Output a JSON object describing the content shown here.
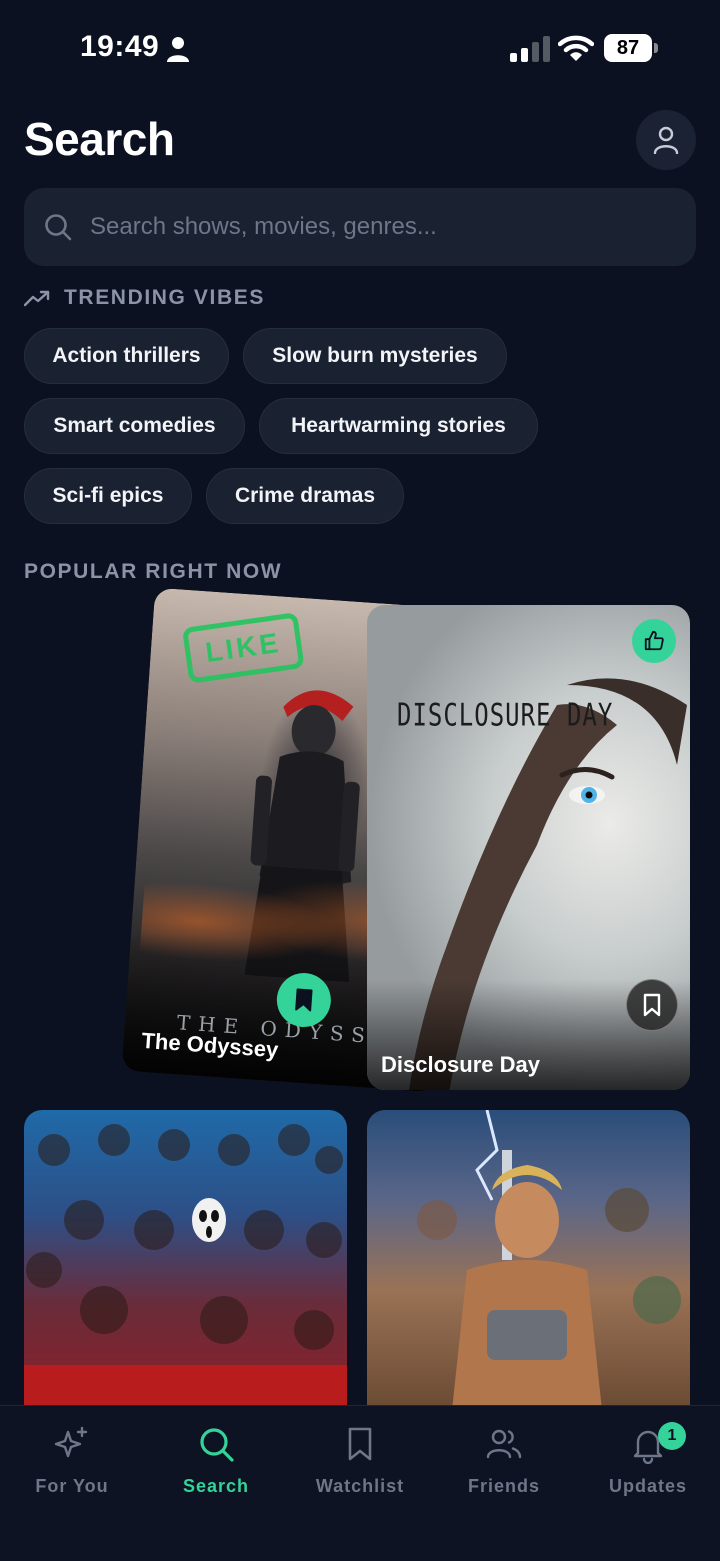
{
  "status_bar": {
    "time": "19:49",
    "battery": "87"
  },
  "header": {
    "title": "Search"
  },
  "search": {
    "placeholder": "Search shows, movies, genres..."
  },
  "trending": {
    "label": "TRENDING VIBES",
    "chips": [
      "Action thrillers",
      "Slow burn mysteries",
      "Smart comedies",
      "Heartwarming stories",
      "Sci-fi epics",
      "Crime dramas"
    ]
  },
  "popular": {
    "label": "POPULAR RIGHT NOW",
    "cards": [
      {
        "title": "The Odyssey",
        "poster_text": "THE ODYSSE",
        "stamp": "LIKE",
        "saved": true
      },
      {
        "title": "Disclosure Day",
        "poster_text": "DISCLOSURE DAY",
        "liked": true,
        "saved": false
      }
    ]
  },
  "nav": {
    "items": [
      {
        "label": "For You",
        "icon": "sparkles-icon"
      },
      {
        "label": "Search",
        "icon": "search-icon"
      },
      {
        "label": "Watchlist",
        "icon": "bookmark-icon"
      },
      {
        "label": "Friends",
        "icon": "users-icon"
      },
      {
        "label": "Updates",
        "icon": "bell-icon"
      }
    ],
    "active": "Search",
    "updates_badge": "1"
  },
  "colors": {
    "accent": "#34d399",
    "background": "#0b1120",
    "surface": "#1a2131",
    "muted": "#8b93a7"
  }
}
